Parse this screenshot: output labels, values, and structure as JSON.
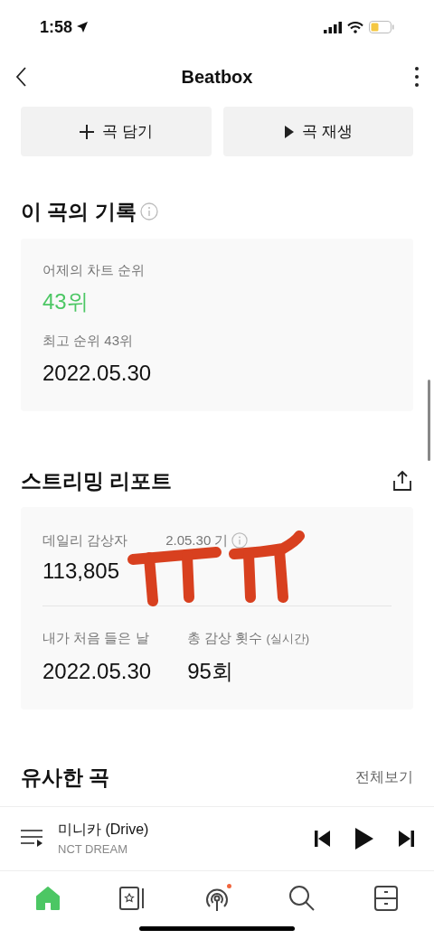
{
  "status_bar": {
    "time": "1:58"
  },
  "header": {
    "title": "Beatbox"
  },
  "actions": [
    {
      "kind": "add",
      "label": "곡 담기"
    },
    {
      "kind": "play",
      "label": "곡 재생"
    }
  ],
  "record": {
    "title": "이 곡의 기록",
    "yesterday_label": "어제의 차트 순위",
    "yesterday_rank": "43위",
    "best_label": "최고 순위 43위",
    "best_date": "2022.05.30"
  },
  "streaming": {
    "title": "스트리밍 리포트",
    "daily_label_parts": [
      "데일리 감상자",
      "2.05.30 기"
    ],
    "daily_value": "113,805",
    "first_label": "내가 처음 들은 날",
    "first_value": "2022.05.30",
    "total_label": "총 감상 횟수",
    "total_sub": "(실시간)",
    "total_value": "95회"
  },
  "similar": {
    "title": "유사한 곡",
    "link": "전체보기"
  },
  "now_playing": {
    "title": "미니카 (Drive)",
    "artist": "NCT DREAM"
  },
  "nav": [
    {
      "kind": "home",
      "selected": true,
      "badge": false
    },
    {
      "kind": "library",
      "selected": false,
      "badge": false
    },
    {
      "kind": "radio",
      "selected": false,
      "badge": true
    },
    {
      "kind": "search",
      "selected": false,
      "badge": false
    },
    {
      "kind": "storage",
      "selected": false,
      "badge": false
    }
  ]
}
